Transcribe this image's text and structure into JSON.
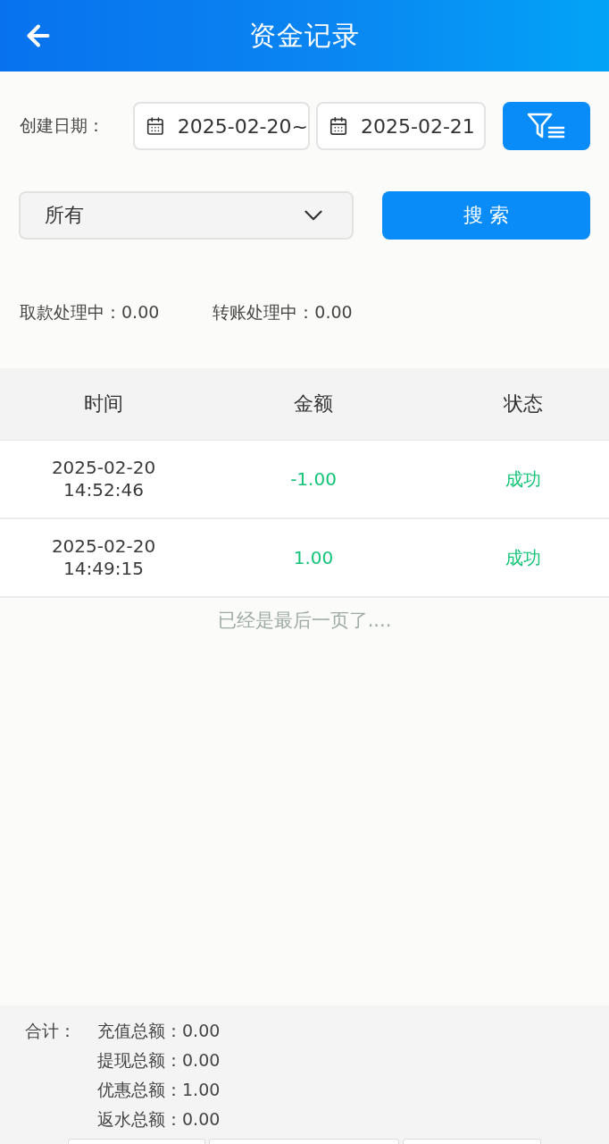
{
  "header": {
    "title": "资金记录"
  },
  "filters": {
    "date_label": "创建日期：",
    "start_date": "2025-02-20~",
    "end_date": "2025-02-21",
    "type_select": {
      "value": "所有"
    },
    "search_button": "搜 索"
  },
  "pending": [
    "取款处理中：0.00",
    "转账处理中：0.00"
  ],
  "table": {
    "columns": [
      "时间",
      "金额",
      "状态"
    ],
    "rows": [
      {
        "date": "2025-02-20",
        "time": "14:52:46",
        "amount": "-1.00",
        "status": "成功"
      },
      {
        "date": "2025-02-20",
        "time": "14:49:15",
        "amount": "1.00",
        "status": "成功"
      }
    ]
  },
  "end_note": "已经是最后一页了....",
  "totals": {
    "label": "合计：",
    "items": [
      "充值总额：0.00",
      "提现总额：0.00",
      "优惠总额：1.00",
      "返水总额：0.00"
    ]
  }
}
